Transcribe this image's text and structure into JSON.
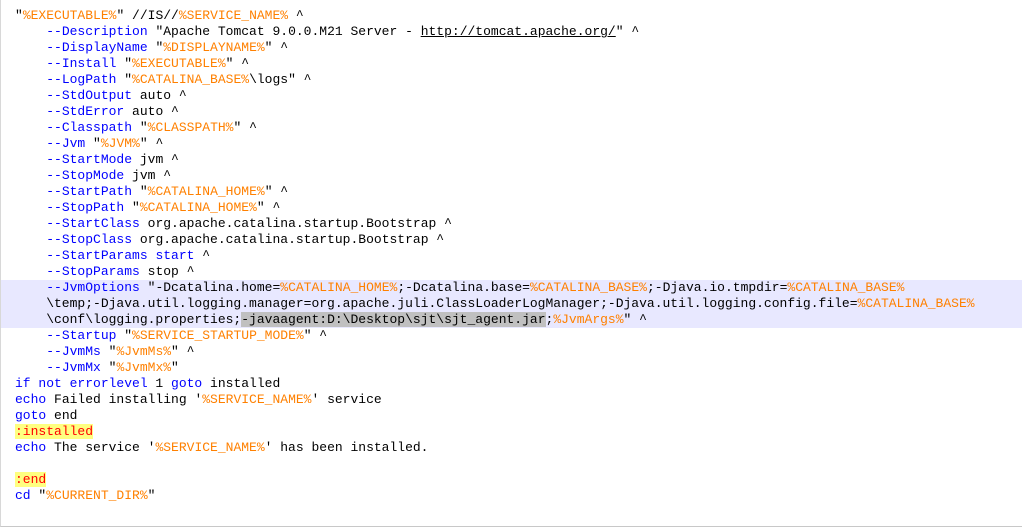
{
  "editor": {
    "colors": {
      "background": "#ffffff",
      "text": "#000000",
      "variable": "#ff8000",
      "option": "#0000ff",
      "keyword": "#0000ff",
      "label": "#ff0000",
      "label_background": "#ffff80",
      "current_line": "#e8e8ff",
      "selection": "#c0c0c0"
    },
    "lines": [
      {
        "tokens": [
          [
            "string",
            "\""
          ],
          [
            "var",
            "%EXECUTABLE%"
          ],
          [
            "string",
            "\""
          ],
          [
            "default",
            " //IS//"
          ],
          [
            "var",
            "%SERVICE_NAME%"
          ],
          [
            "default",
            " ^"
          ]
        ]
      },
      {
        "tokens": [
          [
            "default",
            "    "
          ],
          [
            "option",
            "--Description"
          ],
          [
            "default",
            " \"Apache Tomcat 9.0.0.M21 Server - "
          ],
          [
            "link",
            "http://tomcat.apache.org/"
          ],
          [
            "default",
            "\" ^"
          ]
        ]
      },
      {
        "tokens": [
          [
            "default",
            "    "
          ],
          [
            "option",
            "--DisplayName"
          ],
          [
            "default",
            " \""
          ],
          [
            "var",
            "%DISPLAYNAME%"
          ],
          [
            "default",
            "\" ^"
          ]
        ]
      },
      {
        "tokens": [
          [
            "default",
            "    "
          ],
          [
            "option",
            "--Install"
          ],
          [
            "default",
            " \""
          ],
          [
            "var",
            "%EXECUTABLE%"
          ],
          [
            "default",
            "\" ^"
          ]
        ]
      },
      {
        "tokens": [
          [
            "default",
            "    "
          ],
          [
            "option",
            "--LogPath"
          ],
          [
            "default",
            " \""
          ],
          [
            "var",
            "%CATALINA_BASE%"
          ],
          [
            "default",
            "\\logs\" ^"
          ]
        ]
      },
      {
        "tokens": [
          [
            "default",
            "    "
          ],
          [
            "option",
            "--StdOutput"
          ],
          [
            "default",
            " auto ^"
          ]
        ]
      },
      {
        "tokens": [
          [
            "default",
            "    "
          ],
          [
            "option",
            "--StdError"
          ],
          [
            "default",
            " auto ^"
          ]
        ]
      },
      {
        "tokens": [
          [
            "default",
            "    "
          ],
          [
            "option",
            "--Classpath"
          ],
          [
            "default",
            " \""
          ],
          [
            "var",
            "%CLASSPATH%"
          ],
          [
            "default",
            "\" ^"
          ]
        ]
      },
      {
        "tokens": [
          [
            "default",
            "    "
          ],
          [
            "option",
            "--Jvm"
          ],
          [
            "default",
            " \""
          ],
          [
            "var",
            "%JVM%"
          ],
          [
            "default",
            "\" ^"
          ]
        ]
      },
      {
        "tokens": [
          [
            "default",
            "    "
          ],
          [
            "option",
            "--StartMode"
          ],
          [
            "default",
            " jvm ^"
          ]
        ]
      },
      {
        "tokens": [
          [
            "default",
            "    "
          ],
          [
            "option",
            "--StopMode"
          ],
          [
            "default",
            " jvm ^"
          ]
        ]
      },
      {
        "tokens": [
          [
            "default",
            "    "
          ],
          [
            "option",
            "--StartPath"
          ],
          [
            "default",
            " \""
          ],
          [
            "var",
            "%CATALINA_HOME%"
          ],
          [
            "default",
            "\" ^"
          ]
        ]
      },
      {
        "tokens": [
          [
            "default",
            "    "
          ],
          [
            "option",
            "--StopPath"
          ],
          [
            "default",
            " \""
          ],
          [
            "var",
            "%CATALINA_HOME%"
          ],
          [
            "default",
            "\" ^"
          ]
        ]
      },
      {
        "tokens": [
          [
            "default",
            "    "
          ],
          [
            "option",
            "--StartClass"
          ],
          [
            "default",
            " org.apache.catalina.startup.Bootstrap ^"
          ]
        ]
      },
      {
        "tokens": [
          [
            "default",
            "    "
          ],
          [
            "option",
            "--StopClass"
          ],
          [
            "default",
            " org.apache.catalina.startup.Bootstrap ^"
          ]
        ]
      },
      {
        "tokens": [
          [
            "default",
            "    "
          ],
          [
            "option",
            "--StartParams"
          ],
          [
            "default",
            " "
          ],
          [
            "keyword",
            "start"
          ],
          [
            "default",
            " ^"
          ]
        ]
      },
      {
        "tokens": [
          [
            "default",
            "    "
          ],
          [
            "option",
            "--StopParams"
          ],
          [
            "default",
            " stop ^"
          ]
        ]
      },
      {
        "hl": true,
        "tokens": [
          [
            "default",
            "    "
          ],
          [
            "option",
            "--JvmOptions"
          ],
          [
            "default",
            " \"-Dcatalina.home="
          ],
          [
            "var",
            "%CATALINA_HOME%"
          ],
          [
            "default",
            ";-Dcatalina.base="
          ],
          [
            "var",
            "%CATALINA_BASE%"
          ],
          [
            "default",
            ";-Djava.io.tmpdir="
          ],
          [
            "var",
            "%CATALINA_BASE%"
          ]
        ]
      },
      {
        "hl": true,
        "tokens": [
          [
            "default",
            "    \\temp;-Djava.util.logging.manager=org.apache.juli.ClassLoaderLogManager;-Djava.util.logging.config.file="
          ],
          [
            "var",
            "%CATALINA_BASE%"
          ]
        ]
      },
      {
        "hl": true,
        "tokens": [
          [
            "default",
            "    \\conf\\logging.properties;"
          ],
          [
            "sel",
            "-javaagent:D:\\Desktop\\sjt\\sjt_agent.jar"
          ],
          [
            "default",
            ";"
          ],
          [
            "var",
            "%JvmArgs%"
          ],
          [
            "default",
            "\" ^"
          ]
        ]
      },
      {
        "tokens": [
          [
            "default",
            "    "
          ],
          [
            "option",
            "--Startup"
          ],
          [
            "default",
            " \""
          ],
          [
            "var",
            "%SERVICE_STARTUP_MODE%"
          ],
          [
            "default",
            "\" ^"
          ]
        ]
      },
      {
        "tokens": [
          [
            "default",
            "    "
          ],
          [
            "option",
            "--JvmMs"
          ],
          [
            "default",
            " \""
          ],
          [
            "var",
            "%JvmMs%"
          ],
          [
            "default",
            "\" ^"
          ]
        ]
      },
      {
        "tokens": [
          [
            "default",
            "    "
          ],
          [
            "option",
            "--JvmMx"
          ],
          [
            "default",
            " \""
          ],
          [
            "var",
            "%JvmMx%"
          ],
          [
            "default",
            "\""
          ]
        ]
      },
      {
        "tokens": [
          [
            "keyword",
            "if not errorlevel"
          ],
          [
            "default",
            " 1 "
          ],
          [
            "keyword",
            "goto"
          ],
          [
            "default",
            " installed"
          ]
        ]
      },
      {
        "tokens": [
          [
            "keyword",
            "echo"
          ],
          [
            "default",
            " Failed installing '"
          ],
          [
            "var",
            "%SERVICE_NAME%"
          ],
          [
            "default",
            "' service"
          ]
        ]
      },
      {
        "tokens": [
          [
            "keyword",
            "goto"
          ],
          [
            "default",
            " end"
          ]
        ]
      },
      {
        "tokens": [
          [
            "label",
            ":installed"
          ]
        ]
      },
      {
        "tokens": [
          [
            "keyword",
            "echo"
          ],
          [
            "default",
            " The service '"
          ],
          [
            "var",
            "%SERVICE_NAME%"
          ],
          [
            "default",
            "' has been installed."
          ]
        ]
      },
      {
        "tokens": [
          [
            "default",
            ""
          ]
        ]
      },
      {
        "tokens": [
          [
            "label",
            ":end"
          ]
        ]
      },
      {
        "tokens": [
          [
            "keyword",
            "cd"
          ],
          [
            "default",
            " \""
          ],
          [
            "var",
            "%CURRENT_DIR%"
          ],
          [
            "default",
            "\""
          ]
        ]
      }
    ]
  }
}
